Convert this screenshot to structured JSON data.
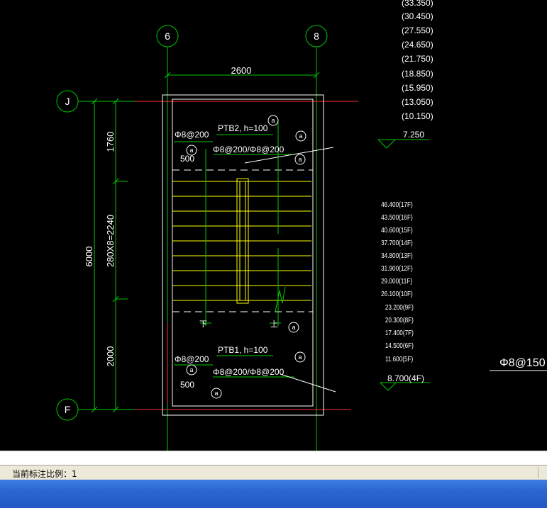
{
  "drawing": {
    "axes": {
      "left": "6",
      "right": "8",
      "top": "J",
      "bottom": "F"
    },
    "dim_top": "2600",
    "dims_left": {
      "total": "6000",
      "upper": "1760",
      "middle": "280X8=2240",
      "lower": "2000"
    },
    "upper_slab": {
      "name": "PTB2, h=100",
      "rebar_left": "Φ8@200",
      "rebar_main": "Φ8@200/Φ8@200",
      "width": "500"
    },
    "lower_slab": {
      "name": "PTB1, h=100",
      "rebar_left": "Φ8@200",
      "rebar_main": "Φ8@200/Φ8@200",
      "width": "500"
    },
    "bubble_mark": "a",
    "up_down": {
      "down": "下",
      "up": "上"
    },
    "elevations_top": [
      "(33.350)",
      "(30.450)",
      "(27.550)",
      "(24.650)",
      "(21.750)",
      "(18.850)",
      "(15.950)",
      "(13.050)",
      "(10.150)"
    ],
    "elevation_top_main": "7.250",
    "elevations_bottom": [
      "46.400(17F)",
      "43.500(16F)",
      "40.600(15F)",
      "37.700(14F)",
      "34.800(13F)",
      "31.900(12F)",
      "29.000(11F)",
      "26.100(10F)",
      "23.200(9F)",
      "20.300(8F)",
      "17.400(7F)",
      "14.500(6F)",
      "11.600(5F)"
    ],
    "elevation_bottom_main": "8.700(4F)",
    "rebar_note": "Φ8@150"
  },
  "status": {
    "scale_label": "当前标注比例：1"
  },
  "colors": {
    "background": "#000000",
    "axis": "#00c800",
    "wall": "#ffffff",
    "stair": "#ffff00",
    "beam": "#ff3030"
  }
}
